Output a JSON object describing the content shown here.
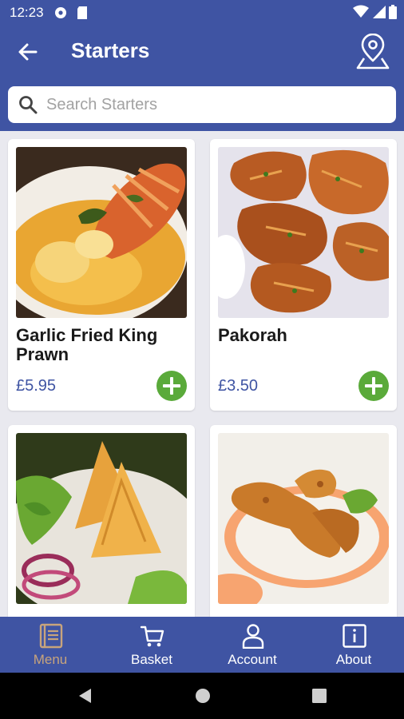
{
  "status": {
    "time": "12:23"
  },
  "header": {
    "title": "Starters"
  },
  "search": {
    "placeholder": "Search Starters"
  },
  "items": [
    {
      "name": "Garlic Fried King Prawn",
      "price": "£5.95"
    },
    {
      "name": "Pakorah",
      "price": "£3.50"
    },
    {
      "name": "",
      "price": ""
    },
    {
      "name": "",
      "price": ""
    }
  ],
  "nav": [
    {
      "label": "Menu",
      "icon": "menu-book-icon",
      "active": true
    },
    {
      "label": "Basket",
      "icon": "cart-icon",
      "active": false
    },
    {
      "label": "Account",
      "icon": "person-icon",
      "active": false
    },
    {
      "label": "About",
      "icon": "info-icon",
      "active": false
    }
  ],
  "colors": {
    "primary": "#3f54a3",
    "add": "#5aaa3a",
    "active_nav": "#c8a47c"
  }
}
